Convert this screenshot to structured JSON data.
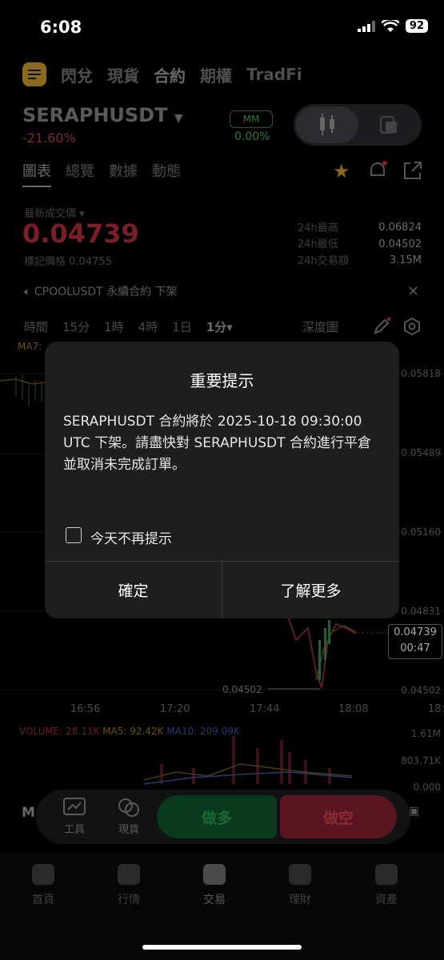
{
  "status_bar": {
    "time": "6:08",
    "battery": "92"
  },
  "top_tabs": [
    "閃兌",
    "現貨",
    "合約",
    "期權",
    "TradFi"
  ],
  "pair": {
    "symbol": "SERAPHUSDT",
    "change": "-21.60%",
    "mm_label": "MM",
    "mm_value": "0.00%"
  },
  "sub_tabs": [
    "圖表",
    "總覽",
    "數據",
    "動態"
  ],
  "price": {
    "last_label": "最新成交價",
    "last_value": "0.04739",
    "mark_label": "標記價格 0.04755",
    "stats": [
      {
        "label": "24h最高",
        "value": "0.06824"
      },
      {
        "label": "24h最低",
        "value": "0.04502"
      },
      {
        "label": "24h交易額",
        "value": "3.15M"
      }
    ]
  },
  "notice": "CPOOLUSDT 永續合約 下架",
  "timeframes": [
    "時間",
    "15分",
    "1時",
    "4時",
    "1日",
    "1分"
  ],
  "depth_label": "深度圖",
  "chart": {
    "ma_label": "MA7:",
    "price_axis": [
      "0.05818",
      "0.05489",
      "0.05160",
      "0.04831",
      "0.04502"
    ],
    "current_price": "0.04739",
    "countdown": "00:47",
    "low_marker": "0.04502",
    "time_axis": [
      "16:56",
      "17:20",
      "17:44",
      "18:08",
      "18:"
    ],
    "volume": {
      "vol": "VOLUME: 28.11K",
      "ma5": "MA5: 92.42K",
      "ma10": "MA10: 209.09K"
    },
    "volume_axis": [
      "1.61M",
      "803.71K",
      "0.000"
    ]
  },
  "trade_bar": {
    "tools": "工具",
    "spot": "現貨",
    "long": "做多",
    "short": "做空",
    "m_label": "M"
  },
  "bottom_nav": [
    "首頁",
    "行情",
    "交易",
    "理財",
    "資產"
  ],
  "modal": {
    "title": "重要提示",
    "body": "SERAPHUSDT 合約將於 2025-10-18 09:30:00 UTC 下架。請盡快對 SERAPHUSDT 合約進行平倉並取消未完成訂單。",
    "checkbox_label": "今天不再提示",
    "confirm": "確定",
    "learn_more": "了解更多"
  },
  "colors": {
    "up": "#1a6a36",
    "down": "#7a1f28",
    "accent": "#d4a020"
  }
}
